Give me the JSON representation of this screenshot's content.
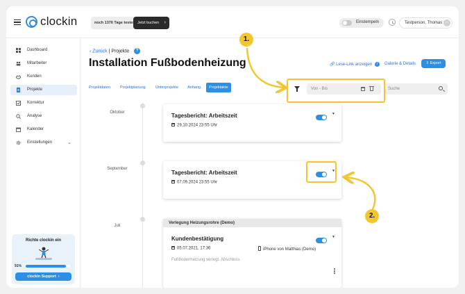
{
  "app": {
    "logo_text": "clockin"
  },
  "header": {
    "trial_text": "noch 1376 Tage testen",
    "trial_button": "Jetzt buchen",
    "clockin_label": "Einstempeln",
    "user_name": "Testperson, Thomas",
    "user_initials": "TT"
  },
  "sidebar": {
    "items": [
      {
        "label": "Dashboard",
        "icon": "dashboard-icon"
      },
      {
        "label": "Mitarbeiter",
        "icon": "employees-icon"
      },
      {
        "label": "Kunden",
        "icon": "customers-icon"
      },
      {
        "label": "Projekte",
        "icon": "projects-icon",
        "active": true
      },
      {
        "label": "Korrektur",
        "icon": "correction-icon"
      },
      {
        "label": "Analyse",
        "icon": "analysis-icon"
      },
      {
        "label": "Kalender",
        "icon": "calendar-icon"
      },
      {
        "label": "Einstellungen",
        "icon": "settings-icon"
      }
    ],
    "promo": {
      "title": "Richte clockin ein",
      "percent": "91%",
      "progress": 0.91,
      "button": "clockin Support"
    }
  },
  "page": {
    "back_link": "Zurück",
    "breadcrumb_current": "Projekte",
    "title": "Installation Fußbodenheizung",
    "read_link": "Lese-Link anzeigen",
    "gallery_link": "Galerie & Details",
    "export_button": "Export"
  },
  "tabs": [
    {
      "label": "Projektdaten"
    },
    {
      "label": "Projektplanung"
    },
    {
      "label": "Unterprojekte"
    },
    {
      "label": "Anhang"
    },
    {
      "label": "Projektakte",
      "active": true
    }
  ],
  "filter": {
    "date_placeholder": "Von - Bis",
    "search_placeholder": "Suche"
  },
  "annotations": {
    "badge_1": "1.",
    "badge_2": "2.",
    "color": "#f2c531"
  },
  "timeline": {
    "months": [
      "Oktober",
      "September",
      "Juli"
    ],
    "entries": [
      {
        "title": "Tagesbericht: Arbeitszeit",
        "date": "29.10.2024 23:55 Uhr"
      },
      {
        "title": "Tagesbericht: Arbeitszeit",
        "date": "07.09.2024 23:55 Uhr"
      },
      {
        "header": "Verlegung Heizungsrohre (Demo)",
        "title": "Kundenbestätigung",
        "date": "05.07.2021, 17:36",
        "device": "iPhone von Matthias (Demo)",
        "description": "Fußbodenheizung verlegt. Abschluss."
      }
    ]
  },
  "colors": {
    "accent": "#2d8fe3",
    "highlight": "#f2c531",
    "active_nav_bg": "#e6effa"
  }
}
